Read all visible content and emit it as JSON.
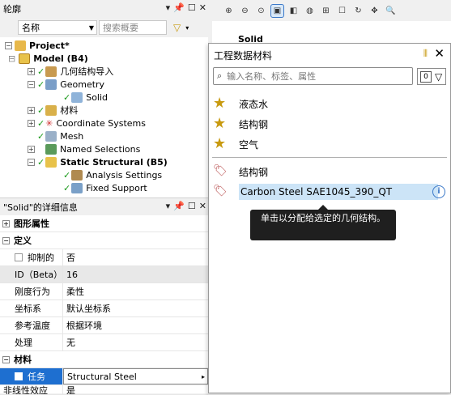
{
  "outline": {
    "title": "轮廓",
    "filter_label": "名称",
    "search_placeholder": "搜索概要",
    "tree": [
      {
        "label": "Project*",
        "bold": true
      },
      {
        "label": "Model (B4)",
        "bold": true
      },
      {
        "label": "几何结构导入"
      },
      {
        "label": "Geometry"
      },
      {
        "label": "Solid"
      },
      {
        "label": "材料"
      },
      {
        "label": "Coordinate Systems"
      },
      {
        "label": "Mesh"
      },
      {
        "label": "Named Selections"
      },
      {
        "label": "Static Structural (B5)",
        "bold": true
      },
      {
        "label": "Analysis Settings"
      },
      {
        "label": "Fixed Support"
      }
    ]
  },
  "details": {
    "title": "\"Solid\"的详细信息",
    "sections": {
      "graphics": "图形属性",
      "definition": "定义",
      "material": "材料"
    },
    "rows": [
      {
        "key": "抑制的",
        "value": "否"
      },
      {
        "key": "ID（Beta）",
        "value": "16"
      },
      {
        "key": "刚度行为",
        "value": "柔性"
      },
      {
        "key": "坐标系",
        "value": "默认坐标系"
      },
      {
        "key": "参考温度",
        "value": "根据环境"
      },
      {
        "key": "处理",
        "value": "无"
      }
    ],
    "material_row": {
      "key": "任务",
      "value": "Structural Steel"
    },
    "cut_row": {
      "key": "非线性效应",
      "value": "是"
    }
  },
  "viewport": {
    "label": "Solid"
  },
  "popup": {
    "title": "工程数据材料",
    "search_placeholder": "输入名称、标签、属性",
    "filter_count": "0",
    "favorites": [
      "液态水",
      "结构钢",
      "空气"
    ],
    "library": [
      "结构钢",
      "Carbon Steel SAE1045_390_QT"
    ],
    "tooltip": "单击以分配给选定的几何结构。"
  },
  "colors": {
    "selection": "#cce4f7",
    "tooltip_bg": "#1f1f1f",
    "star": "#c89a10",
    "material_row": "#1e6fd0"
  }
}
